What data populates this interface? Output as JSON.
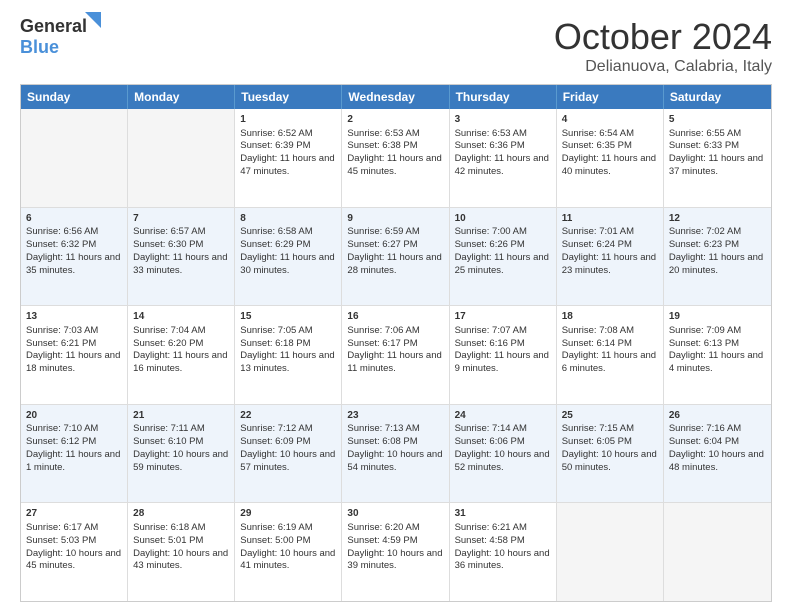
{
  "logo": {
    "part1": "General",
    "part2": "Blue"
  },
  "title": "October 2024",
  "subtitle": "Delianuova, Calabria, Italy",
  "headers": [
    "Sunday",
    "Monday",
    "Tuesday",
    "Wednesday",
    "Thursday",
    "Friday",
    "Saturday"
  ],
  "rows": [
    [
      {
        "day": "",
        "sunrise": "",
        "sunset": "",
        "daylight": "",
        "empty": true
      },
      {
        "day": "",
        "sunrise": "",
        "sunset": "",
        "daylight": "",
        "empty": true
      },
      {
        "day": "1",
        "sunrise": "Sunrise: 6:52 AM",
        "sunset": "Sunset: 6:39 PM",
        "daylight": "Daylight: 11 hours and 47 minutes."
      },
      {
        "day": "2",
        "sunrise": "Sunrise: 6:53 AM",
        "sunset": "Sunset: 6:38 PM",
        "daylight": "Daylight: 11 hours and 45 minutes."
      },
      {
        "day": "3",
        "sunrise": "Sunrise: 6:53 AM",
        "sunset": "Sunset: 6:36 PM",
        "daylight": "Daylight: 11 hours and 42 minutes."
      },
      {
        "day": "4",
        "sunrise": "Sunrise: 6:54 AM",
        "sunset": "Sunset: 6:35 PM",
        "daylight": "Daylight: 11 hours and 40 minutes."
      },
      {
        "day": "5",
        "sunrise": "Sunrise: 6:55 AM",
        "sunset": "Sunset: 6:33 PM",
        "daylight": "Daylight: 11 hours and 37 minutes."
      }
    ],
    [
      {
        "day": "6",
        "sunrise": "Sunrise: 6:56 AM",
        "sunset": "Sunset: 6:32 PM",
        "daylight": "Daylight: 11 hours and 35 minutes."
      },
      {
        "day": "7",
        "sunrise": "Sunrise: 6:57 AM",
        "sunset": "Sunset: 6:30 PM",
        "daylight": "Daylight: 11 hours and 33 minutes."
      },
      {
        "day": "8",
        "sunrise": "Sunrise: 6:58 AM",
        "sunset": "Sunset: 6:29 PM",
        "daylight": "Daylight: 11 hours and 30 minutes."
      },
      {
        "day": "9",
        "sunrise": "Sunrise: 6:59 AM",
        "sunset": "Sunset: 6:27 PM",
        "daylight": "Daylight: 11 hours and 28 minutes."
      },
      {
        "day": "10",
        "sunrise": "Sunrise: 7:00 AM",
        "sunset": "Sunset: 6:26 PM",
        "daylight": "Daylight: 11 hours and 25 minutes."
      },
      {
        "day": "11",
        "sunrise": "Sunrise: 7:01 AM",
        "sunset": "Sunset: 6:24 PM",
        "daylight": "Daylight: 11 hours and 23 minutes."
      },
      {
        "day": "12",
        "sunrise": "Sunrise: 7:02 AM",
        "sunset": "Sunset: 6:23 PM",
        "daylight": "Daylight: 11 hours and 20 minutes."
      }
    ],
    [
      {
        "day": "13",
        "sunrise": "Sunrise: 7:03 AM",
        "sunset": "Sunset: 6:21 PM",
        "daylight": "Daylight: 11 hours and 18 minutes."
      },
      {
        "day": "14",
        "sunrise": "Sunrise: 7:04 AM",
        "sunset": "Sunset: 6:20 PM",
        "daylight": "Daylight: 11 hours and 16 minutes."
      },
      {
        "day": "15",
        "sunrise": "Sunrise: 7:05 AM",
        "sunset": "Sunset: 6:18 PM",
        "daylight": "Daylight: 11 hours and 13 minutes."
      },
      {
        "day": "16",
        "sunrise": "Sunrise: 7:06 AM",
        "sunset": "Sunset: 6:17 PM",
        "daylight": "Daylight: 11 hours and 11 minutes."
      },
      {
        "day": "17",
        "sunrise": "Sunrise: 7:07 AM",
        "sunset": "Sunset: 6:16 PM",
        "daylight": "Daylight: 11 hours and 9 minutes."
      },
      {
        "day": "18",
        "sunrise": "Sunrise: 7:08 AM",
        "sunset": "Sunset: 6:14 PM",
        "daylight": "Daylight: 11 hours and 6 minutes."
      },
      {
        "day": "19",
        "sunrise": "Sunrise: 7:09 AM",
        "sunset": "Sunset: 6:13 PM",
        "daylight": "Daylight: 11 hours and 4 minutes."
      }
    ],
    [
      {
        "day": "20",
        "sunrise": "Sunrise: 7:10 AM",
        "sunset": "Sunset: 6:12 PM",
        "daylight": "Daylight: 11 hours and 1 minute."
      },
      {
        "day": "21",
        "sunrise": "Sunrise: 7:11 AM",
        "sunset": "Sunset: 6:10 PM",
        "daylight": "Daylight: 10 hours and 59 minutes."
      },
      {
        "day": "22",
        "sunrise": "Sunrise: 7:12 AM",
        "sunset": "Sunset: 6:09 PM",
        "daylight": "Daylight: 10 hours and 57 minutes."
      },
      {
        "day": "23",
        "sunrise": "Sunrise: 7:13 AM",
        "sunset": "Sunset: 6:08 PM",
        "daylight": "Daylight: 10 hours and 54 minutes."
      },
      {
        "day": "24",
        "sunrise": "Sunrise: 7:14 AM",
        "sunset": "Sunset: 6:06 PM",
        "daylight": "Daylight: 10 hours and 52 minutes."
      },
      {
        "day": "25",
        "sunrise": "Sunrise: 7:15 AM",
        "sunset": "Sunset: 6:05 PM",
        "daylight": "Daylight: 10 hours and 50 minutes."
      },
      {
        "day": "26",
        "sunrise": "Sunrise: 7:16 AM",
        "sunset": "Sunset: 6:04 PM",
        "daylight": "Daylight: 10 hours and 48 minutes."
      }
    ],
    [
      {
        "day": "27",
        "sunrise": "Sunrise: 6:17 AM",
        "sunset": "Sunset: 5:03 PM",
        "daylight": "Daylight: 10 hours and 45 minutes."
      },
      {
        "day": "28",
        "sunrise": "Sunrise: 6:18 AM",
        "sunset": "Sunset: 5:01 PM",
        "daylight": "Daylight: 10 hours and 43 minutes."
      },
      {
        "day": "29",
        "sunrise": "Sunrise: 6:19 AM",
        "sunset": "Sunset: 5:00 PM",
        "daylight": "Daylight: 10 hours and 41 minutes."
      },
      {
        "day": "30",
        "sunrise": "Sunrise: 6:20 AM",
        "sunset": "Sunset: 4:59 PM",
        "daylight": "Daylight: 10 hours and 39 minutes."
      },
      {
        "day": "31",
        "sunrise": "Sunrise: 6:21 AM",
        "sunset": "Sunset: 4:58 PM",
        "daylight": "Daylight: 10 hours and 36 minutes."
      },
      {
        "day": "",
        "sunrise": "",
        "sunset": "",
        "daylight": "",
        "empty": true
      },
      {
        "day": "",
        "sunrise": "",
        "sunset": "",
        "daylight": "",
        "empty": true
      }
    ]
  ]
}
